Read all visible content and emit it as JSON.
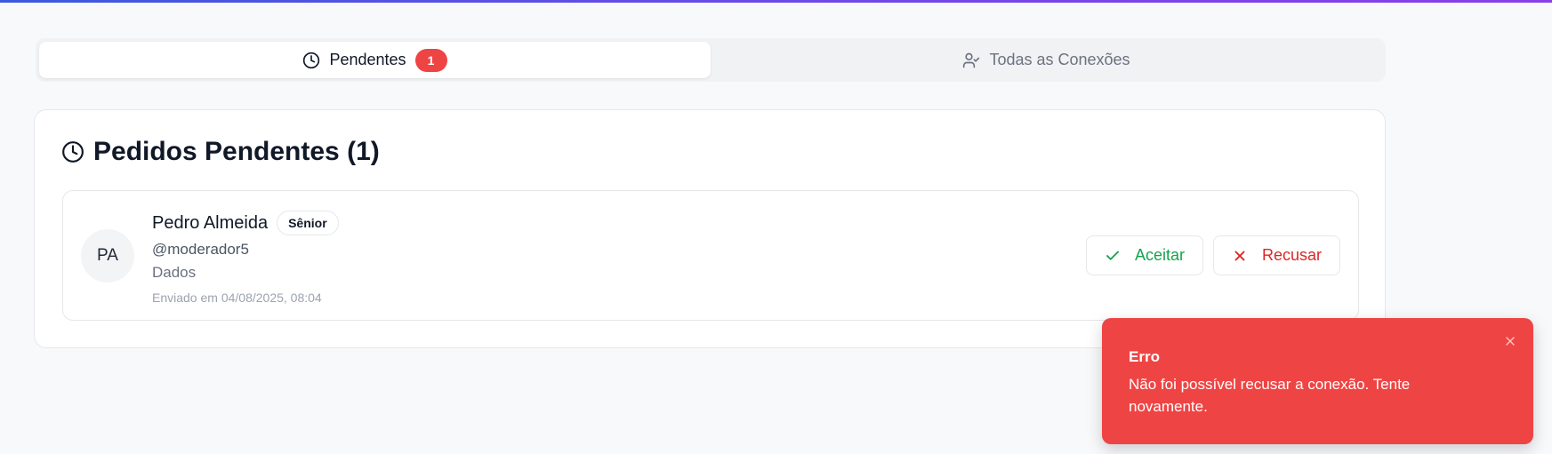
{
  "tabs": {
    "pending": {
      "label": "Pendentes",
      "count": "1",
      "icon": "clock-icon"
    },
    "all": {
      "label": "Todas as Conexões",
      "icon": "user-check-icon"
    }
  },
  "card": {
    "title": "Pedidos Pendentes (1)",
    "icon": "clock-icon"
  },
  "request": {
    "initials": "PA",
    "name": "Pedro Almeida",
    "level": "Sênior",
    "username": "@moderador5",
    "area": "Dados",
    "sent": "Enviado em 04/08/2025, 08:04",
    "accept_label": "Aceitar",
    "reject_label": "Recusar"
  },
  "toast": {
    "title": "Erro",
    "message": "Não foi possível recusar a conexão. Tente novamente.",
    "color": "#ef4444"
  },
  "colors": {
    "accept": "#16a34a",
    "reject": "#dc2626",
    "badge": "#ef4444"
  }
}
